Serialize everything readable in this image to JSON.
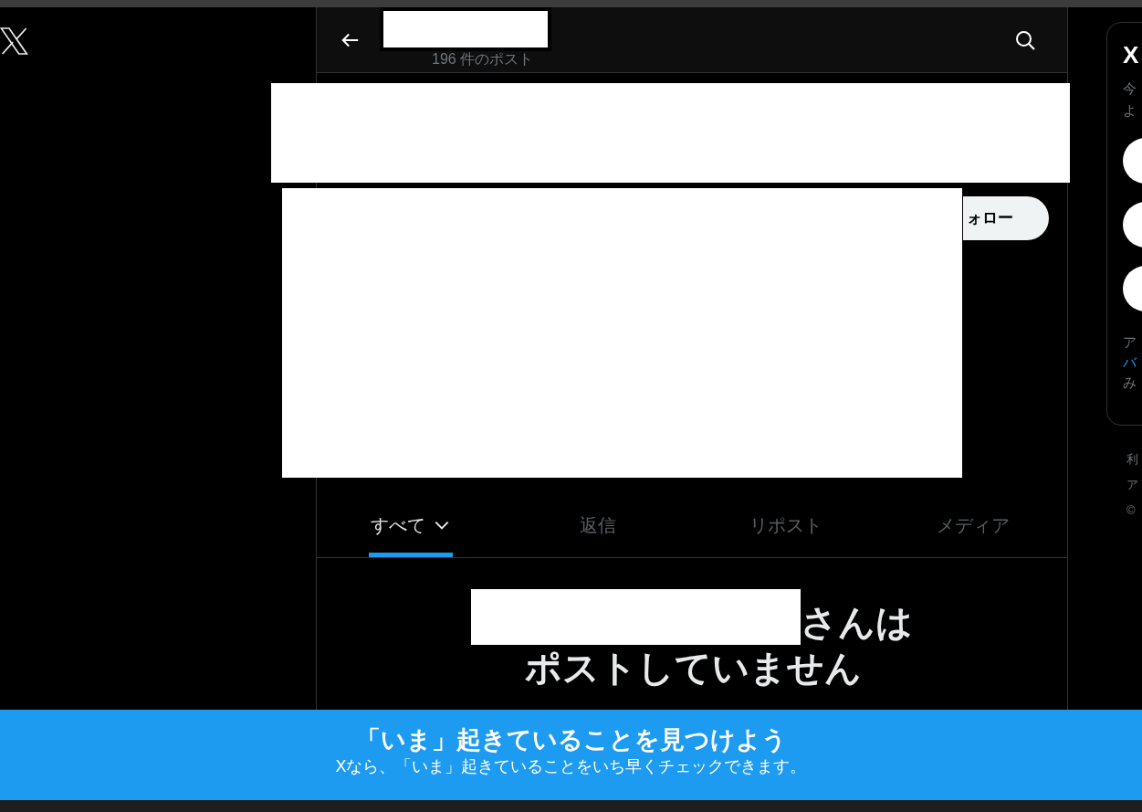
{
  "header": {
    "post_count": "196 件のポスト"
  },
  "follow_button": {
    "label": "ォロー"
  },
  "tabs": [
    {
      "label": "すべて",
      "selected": true,
      "dropdown": true
    },
    {
      "label": "返信",
      "selected": false,
      "dropdown": false
    },
    {
      "label": "リポスト",
      "selected": false,
      "dropdown": false
    },
    {
      "label": "メディア",
      "selected": false,
      "dropdown": false
    }
  ],
  "empty_state": {
    "title_suffix": "さんは",
    "title_line2": "ポストしていません"
  },
  "sidebar_card": {
    "title": "X",
    "intro": [
      "今",
      "よ"
    ],
    "note": [
      {
        "text": "ア",
        "kind": "muted"
      },
      {
        "text": "バ",
        "kind": "link"
      },
      {
        "text": "み",
        "kind": "muted"
      }
    ]
  },
  "footer_links": [
    "利",
    "ア",
    "©"
  ],
  "banner": {
    "title": "「いま」起きていることを見つけよう",
    "subtitle": "Xなら、「いま」起きていることをいち早くチェックできます。"
  }
}
